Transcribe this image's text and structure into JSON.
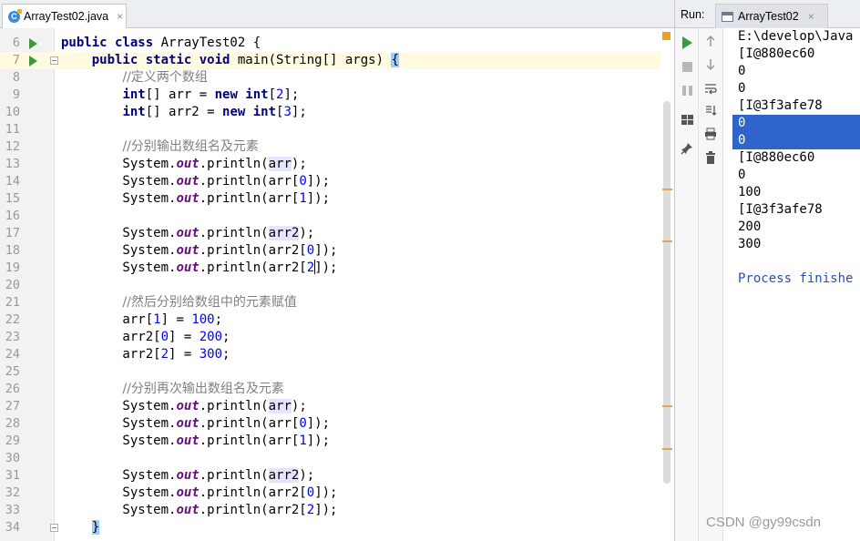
{
  "editor": {
    "tab": {
      "label": "ArrayTest02.java",
      "close": "×"
    },
    "lines": [
      {
        "n": "6",
        "run": true,
        "fold": false,
        "current": false,
        "segs": [
          [
            "kw",
            "public class "
          ],
          [
            "",
            "ArrayTest02 {"
          ]
        ]
      },
      {
        "n": "7",
        "run": true,
        "fold": true,
        "current": true,
        "segs": [
          [
            "",
            "    "
          ],
          [
            "kw",
            "public static void "
          ],
          [
            "",
            "main(String[] args) "
          ],
          [
            "brk",
            "{"
          ]
        ]
      },
      {
        "n": "8",
        "segs": [
          [
            "",
            "        "
          ],
          [
            "cm",
            "//定义两个数组"
          ]
        ]
      },
      {
        "n": "9",
        "segs": [
          [
            "",
            "        "
          ],
          [
            "kw",
            "int"
          ],
          [
            "",
            "[] arr = "
          ],
          [
            "kw",
            "new int"
          ],
          [
            "",
            "["
          ],
          [
            "num",
            "2"
          ],
          [
            "",
            "];"
          ]
        ]
      },
      {
        "n": "10",
        "segs": [
          [
            "",
            "        "
          ],
          [
            "kw",
            "int"
          ],
          [
            "",
            "[] arr2 = "
          ],
          [
            "kw",
            "new int"
          ],
          [
            "",
            "["
          ],
          [
            "num",
            "3"
          ],
          [
            "",
            "];"
          ]
        ]
      },
      {
        "n": "11",
        "segs": []
      },
      {
        "n": "12",
        "segs": [
          [
            "",
            "        "
          ],
          [
            "cm",
            "//分别输出数组名及元素"
          ]
        ]
      },
      {
        "n": "13",
        "segs": [
          [
            "",
            "        System."
          ],
          [
            "fld",
            "out"
          ],
          [
            "",
            ".println("
          ],
          [
            "hl",
            "arr"
          ],
          [
            "",
            ");"
          ]
        ]
      },
      {
        "n": "14",
        "segs": [
          [
            "",
            "        System."
          ],
          [
            "fld",
            "out"
          ],
          [
            "",
            ".println(arr["
          ],
          [
            "num",
            "0"
          ],
          [
            "",
            "]);"
          ]
        ]
      },
      {
        "n": "15",
        "segs": [
          [
            "",
            "        System."
          ],
          [
            "fld",
            "out"
          ],
          [
            "",
            ".println(arr["
          ],
          [
            "num",
            "1"
          ],
          [
            "",
            "]);"
          ]
        ]
      },
      {
        "n": "16",
        "segs": []
      },
      {
        "n": "17",
        "segs": [
          [
            "",
            "        System."
          ],
          [
            "fld",
            "out"
          ],
          [
            "",
            ".println("
          ],
          [
            "hl",
            "arr2"
          ],
          [
            "",
            ");"
          ]
        ]
      },
      {
        "n": "18",
        "segs": [
          [
            "",
            "        System."
          ],
          [
            "fld",
            "out"
          ],
          [
            "",
            ".println(arr2["
          ],
          [
            "num",
            "0"
          ],
          [
            "",
            "]);"
          ]
        ]
      },
      {
        "n": "19",
        "segs": [
          [
            "",
            "        System."
          ],
          [
            "fld",
            "out"
          ],
          [
            "",
            ".println(arr2["
          ],
          [
            "num",
            "2"
          ],
          [
            "caret",
            ""
          ],
          [
            "",
            "]);"
          ]
        ]
      },
      {
        "n": "20",
        "segs": []
      },
      {
        "n": "21",
        "segs": [
          [
            "",
            "        "
          ],
          [
            "cm",
            "//然后分别给数组中的元素赋值"
          ]
        ]
      },
      {
        "n": "22",
        "segs": [
          [
            "",
            "        arr["
          ],
          [
            "num",
            "1"
          ],
          [
            "",
            "] = "
          ],
          [
            "num",
            "100"
          ],
          [
            "",
            ";"
          ]
        ]
      },
      {
        "n": "23",
        "segs": [
          [
            "",
            "        arr2["
          ],
          [
            "num",
            "0"
          ],
          [
            "",
            "] = "
          ],
          [
            "num",
            "200"
          ],
          [
            "",
            ";"
          ]
        ]
      },
      {
        "n": "24",
        "segs": [
          [
            "",
            "        arr2["
          ],
          [
            "num",
            "2"
          ],
          [
            "",
            "] = "
          ],
          [
            "num",
            "300"
          ],
          [
            "",
            ";"
          ]
        ]
      },
      {
        "n": "25",
        "segs": []
      },
      {
        "n": "26",
        "segs": [
          [
            "",
            "        "
          ],
          [
            "cm",
            "//分别再次输出数组名及元素"
          ]
        ]
      },
      {
        "n": "27",
        "segs": [
          [
            "",
            "        System."
          ],
          [
            "fld",
            "out"
          ],
          [
            "",
            ".println("
          ],
          [
            "hl",
            "arr"
          ],
          [
            "",
            ");"
          ]
        ]
      },
      {
        "n": "28",
        "segs": [
          [
            "",
            "        System."
          ],
          [
            "fld",
            "out"
          ],
          [
            "",
            ".println(arr["
          ],
          [
            "num",
            "0"
          ],
          [
            "",
            "]);"
          ]
        ]
      },
      {
        "n": "29",
        "segs": [
          [
            "",
            "        System."
          ],
          [
            "fld",
            "out"
          ],
          [
            "",
            ".println(arr["
          ],
          [
            "num",
            "1"
          ],
          [
            "",
            "]);"
          ]
        ]
      },
      {
        "n": "30",
        "segs": []
      },
      {
        "n": "31",
        "segs": [
          [
            "",
            "        System."
          ],
          [
            "fld",
            "out"
          ],
          [
            "",
            ".println("
          ],
          [
            "hl",
            "arr2"
          ],
          [
            "",
            ");"
          ]
        ]
      },
      {
        "n": "32",
        "segs": [
          [
            "",
            "        System."
          ],
          [
            "fld",
            "out"
          ],
          [
            "",
            ".println(arr2["
          ],
          [
            "num",
            "0"
          ],
          [
            "",
            "]);"
          ]
        ]
      },
      {
        "n": "33",
        "segs": [
          [
            "",
            "        System."
          ],
          [
            "fld",
            "out"
          ],
          [
            "",
            ".println(arr2["
          ],
          [
            "num",
            "2"
          ],
          [
            "",
            "]);"
          ]
        ]
      },
      {
        "n": "34",
        "fold": true,
        "segs": [
          [
            "",
            "    "
          ],
          [
            "brk",
            "}"
          ]
        ]
      }
    ]
  },
  "run": {
    "label": "Run:",
    "tab": {
      "label": "ArrayTest02",
      "close": "×"
    },
    "console": [
      {
        "text": "E:\\develop\\Java"
      },
      {
        "text": "[I@880ec60"
      },
      {
        "text": "0"
      },
      {
        "text": "0"
      },
      {
        "text": "[I@3f3afe78"
      },
      {
        "text": "0",
        "selected": true
      },
      {
        "text": "0",
        "selected": true
      },
      {
        "text": "[I@880ec60"
      },
      {
        "text": "0"
      },
      {
        "text": "100"
      },
      {
        "text": "[I@3f3afe78"
      },
      {
        "text": "200"
      },
      {
        "text": "300"
      },
      {
        "text": ""
      },
      {
        "text": "Process finishe",
        "finish": true
      }
    ],
    "toolbar_left": [
      "rerun-icon",
      "stop-icon",
      "pause-icon",
      "layout-icon",
      "pin-icon"
    ],
    "toolbar_right": [
      "up-arrow-icon",
      "down-arrow-icon",
      "wrap-icon",
      "scroll-end-icon",
      "print-icon",
      "trash-icon"
    ]
  },
  "watermark": "CSDN @gy99csdn",
  "colors": {
    "keyword": "#000080",
    "comment": "#808080",
    "field": "#660e7a",
    "number": "#0000ff",
    "selection": "#2f65ca",
    "run_green": "#3c9a3c"
  }
}
